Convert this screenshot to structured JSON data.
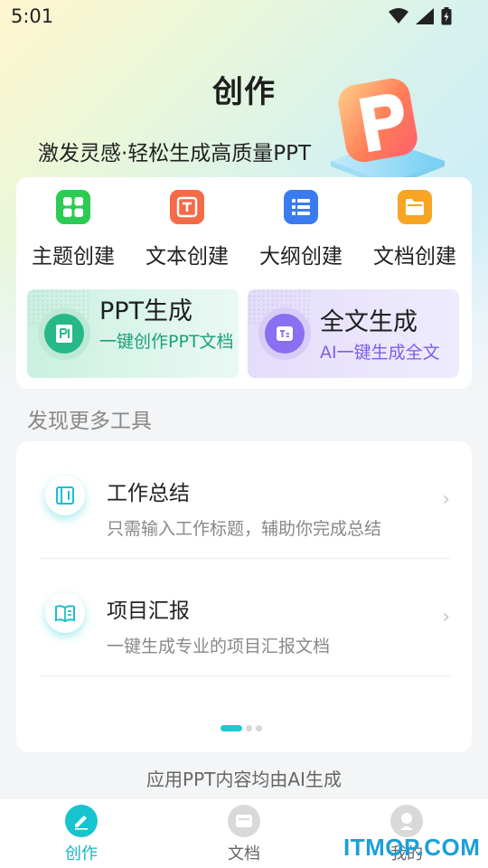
{
  "status_bar": {
    "time": "5:01"
  },
  "header": {
    "title": "创作",
    "tagline": "激发灵感·轻松生成高质量PPT"
  },
  "quick_actions": [
    {
      "label": "主题创建",
      "icon": "grid-icon",
      "color": "#2ecb54"
    },
    {
      "label": "文本创建",
      "icon": "text-frame-icon",
      "color": "#f46b4a"
    },
    {
      "label": "大纲创建",
      "icon": "list-icon",
      "color": "#3a7cf0"
    },
    {
      "label": "文档创建",
      "icon": "folder-icon",
      "color": "#f7a523"
    }
  ],
  "generators": {
    "ppt": {
      "title": "PPT生成",
      "subtitle": "一键创作PPT文档"
    },
    "full_text": {
      "title": "全文生成",
      "subtitle": "AI一键生成全文"
    }
  },
  "section": {
    "title": "发现更多工具"
  },
  "tools": [
    {
      "title": "工作总结",
      "description": "只需输入工作标题，辅助你完成总结",
      "icon": "book-icon"
    },
    {
      "title": "项目汇报",
      "description": "一键生成专业的项目汇报文档",
      "icon": "open-book-icon"
    }
  ],
  "pager": {
    "pages": 3,
    "active": 1
  },
  "footer_note": "应用PPT内容均由AI生成",
  "bottom_nav": [
    {
      "label": "创作",
      "active": true
    },
    {
      "label": "文档",
      "active": false
    },
    {
      "label": "我的",
      "active": false
    }
  ],
  "watermark": "ITMOP.COM",
  "colors": {
    "accent": "#15c4cf",
    "ppt_green": "#27b88a",
    "full_purple": "#8a6ff0"
  }
}
